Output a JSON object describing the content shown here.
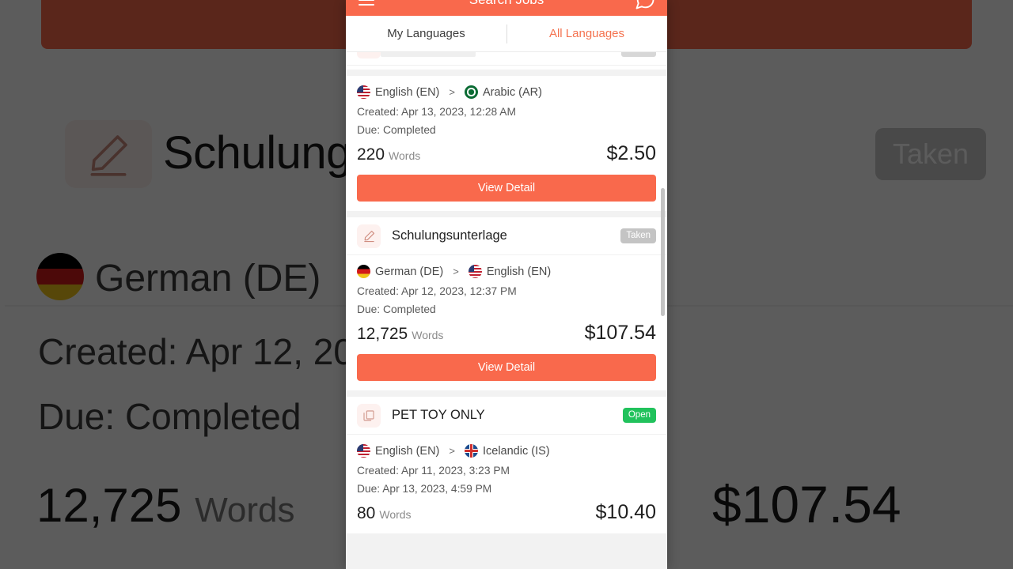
{
  "app": {
    "title": "Search Jobs",
    "menu_icon": "hamburger-icon",
    "action_icon": "search-bubble-icon"
  },
  "tabs": [
    {
      "label": "My Languages",
      "name": "tab-my-languages",
      "active": true
    },
    {
      "label": "All Languages",
      "name": "tab-all-languages",
      "active": false
    }
  ],
  "colors": {
    "accent": "#f9694c",
    "accent_text": "#f4724f",
    "badge_taken": "#c4c4c4",
    "badge_open": "#21c25c",
    "list_bg": "#f2f2f2"
  },
  "labels": {
    "words_unit": "Words",
    "arrow": ">",
    "view_detail": "View Detail"
  },
  "jobs": [
    {
      "title": "",
      "badge": "",
      "icon": "document-icon",
      "source_lang": "English (EN)",
      "source_flag": "us-flag-icon",
      "target_lang": "Arabic (AR)",
      "target_flag": "saudi-arabia-flag-icon",
      "created": "Created: Apr 13, 2023, 12:28 AM",
      "due": "Due: Completed",
      "words": "220",
      "price": "$2.50",
      "button": "View Detail"
    },
    {
      "title": "Schulungsunterlage",
      "badge": "Taken",
      "icon": "pencil-icon",
      "source_lang": "German (DE)",
      "source_flag": "germany-flag-icon",
      "target_lang": "English (EN)",
      "target_flag": "us-flag-icon",
      "created": "Created: Apr 12, 2023, 12:37 PM",
      "due": "Due: Completed",
      "words": "12,725",
      "price": "$107.54",
      "button": "View Detail"
    },
    {
      "title": "PET TOY ONLY",
      "badge": "Open",
      "icon": "copy-document-icon",
      "source_lang": "English (EN)",
      "source_flag": "us-flag-icon",
      "target_lang": "Icelandic (IS)",
      "target_flag": "iceland-flag-icon",
      "created": "Created: Apr 11, 2023, 3:23 PM",
      "due": "Due: Apr 13, 2023, 4:59 PM",
      "words": "80",
      "price": "$10.40",
      "button": "View Detail"
    }
  ],
  "background": {
    "title": "Schulungs",
    "badge": "Taken",
    "lang": "German (DE)",
    "created": "Created: Apr 12, 20",
    "due": "Due: Completed",
    "words": "12,725",
    "words_unit": "Words",
    "price": "$107.54"
  }
}
